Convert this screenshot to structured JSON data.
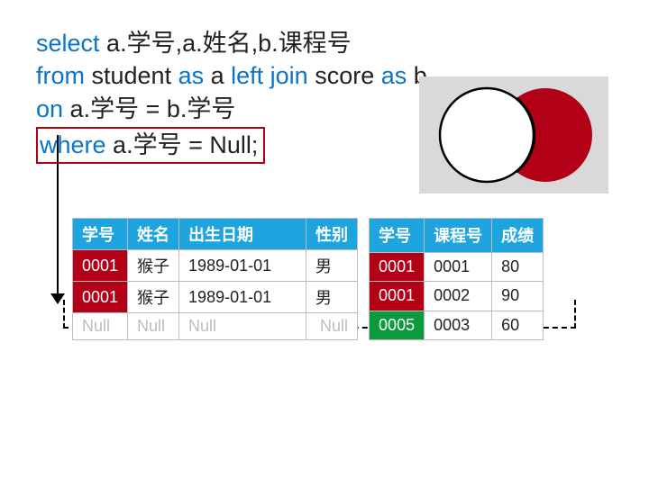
{
  "sql": {
    "select_kw": "select",
    "select_cols": " a.学号,a.姓名,b.课程号",
    "from_kw": "from",
    "from_tbl": " student ",
    "as1_kw": "as",
    "alias_a": " a  ",
    "leftjoin_kw": "left join",
    "join_tbl": " score ",
    "as2_kw": "as",
    "alias_b": " b",
    "on_kw": "on",
    "on_cond": " a.学号 = b.学号",
    "where_kw": "where",
    "where_cond": " a.学号 = Null;"
  },
  "left_table": {
    "headers": [
      "学号",
      "姓名",
      "出生日期",
      "性别"
    ],
    "rows": [
      {
        "id": "0001",
        "name": "猴子",
        "dob": "1989-01-01",
        "sex": "男"
      },
      {
        "id": "0001",
        "name": "猴子",
        "dob": "1989-01-01",
        "sex": "男"
      }
    ],
    "null_row": [
      "Null",
      "Null",
      "Null",
      "Null"
    ]
  },
  "right_table": {
    "headers": [
      "学号",
      "课程号",
      "成绩"
    ],
    "rows": [
      {
        "id": "0001",
        "course": "0001",
        "score": "80",
        "cls": "red"
      },
      {
        "id": "0001",
        "course": "0002",
        "score": "90",
        "cls": "red"
      },
      {
        "id": "0005",
        "course": "0003",
        "score": "60",
        "cls": "green"
      }
    ]
  }
}
